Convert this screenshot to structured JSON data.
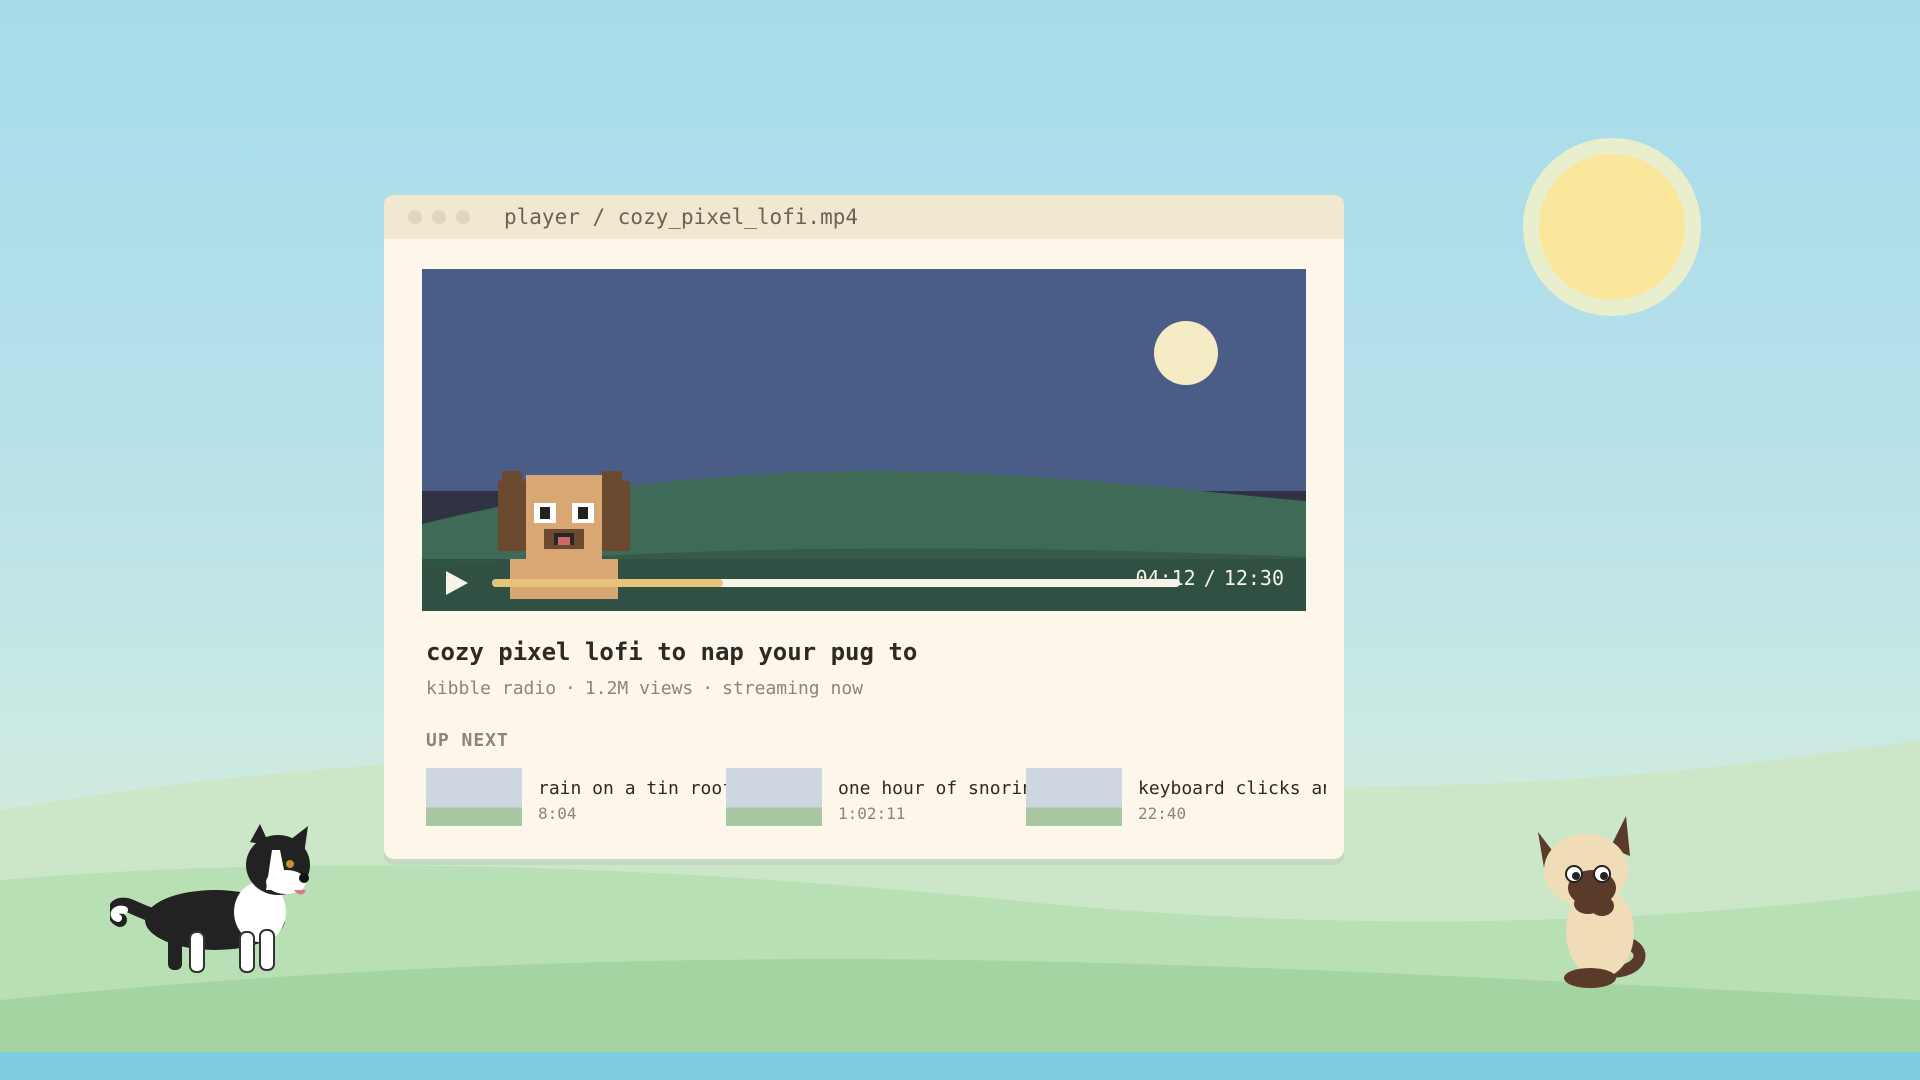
{
  "window": {
    "title": "player / cozy_pixel_lofi.mp4"
  },
  "player": {
    "elapsed": "04:12",
    "separator": "/",
    "duration": "12:30",
    "progress_fraction": 0.336,
    "play_icon": "play-icon"
  },
  "video": {
    "title": "cozy pixel lofi to nap your pug to",
    "channel": "kibble radio",
    "views": "1.2M views",
    "status": "streaming now",
    "meta_separator": "·"
  },
  "up_next": {
    "label": "UP NEXT",
    "items": [
      {
        "title": "rain on a tin roof",
        "duration": "8:04"
      },
      {
        "title": "one hour of snoring",
        "duration": "1:02:11"
      },
      {
        "title": "keyboard clicks and",
        "duration": "22:40"
      }
    ]
  },
  "colors": {
    "sky_top": "#a7dbe9",
    "sun": "#fbe79c",
    "window_bg": "#fcf7ea",
    "titlebar_bg": "#f2e7d0",
    "video_sky": "#4a5d86",
    "video_hill": "#3f6a57",
    "progress_fill": "#e8c27a",
    "grass": "#a3d4a1"
  },
  "decor": {
    "left_pet": "border-collie-dog",
    "right_pet": "siamese-cat"
  }
}
